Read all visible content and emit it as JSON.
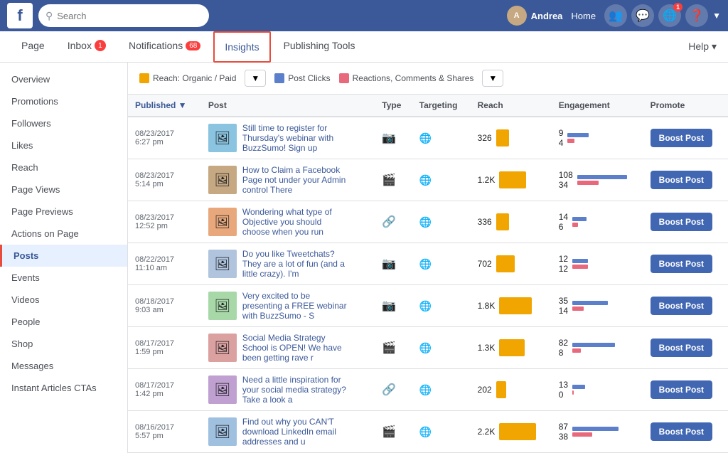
{
  "topNav": {
    "logo": "f",
    "search": {
      "placeholder": "Search",
      "value": ""
    },
    "userName": "Andrea",
    "navItems": [
      "Home",
      "Find Friends",
      "Messenger",
      "Globe",
      "Help",
      "More"
    ],
    "notifCount": "1"
  },
  "pageNav": {
    "items": [
      {
        "label": "Page",
        "active": false
      },
      {
        "label": "Inbox",
        "badge": "1",
        "active": false
      },
      {
        "label": "Notifications",
        "badge": "68",
        "active": false
      },
      {
        "label": "Insights",
        "active": true
      },
      {
        "label": "Publishing Tools",
        "active": false
      }
    ],
    "helpLabel": "Help ▾"
  },
  "sidebar": {
    "items": [
      {
        "label": "Overview",
        "active": false
      },
      {
        "label": "Promotions",
        "active": false
      },
      {
        "label": "Followers",
        "active": false
      },
      {
        "label": "Likes",
        "active": false
      },
      {
        "label": "Reach",
        "active": false
      },
      {
        "label": "Page Views",
        "active": false
      },
      {
        "label": "Page Previews",
        "active": false
      },
      {
        "label": "Actions on Page",
        "active": false
      },
      {
        "label": "Posts",
        "active": true
      },
      {
        "label": "Events",
        "active": false
      },
      {
        "label": "Videos",
        "active": false
      },
      {
        "label": "People",
        "active": false
      },
      {
        "label": "Shop",
        "active": false
      },
      {
        "label": "Messages",
        "active": false
      },
      {
        "label": "Instant Articles CTAs",
        "active": false
      }
    ]
  },
  "toolbar": {
    "reach_label": "Reach: Organic / Paid",
    "postclicks_label": "Post Clicks",
    "reactions_label": "Reactions, Comments & Shares",
    "reach_color": "#f0a500",
    "postclicks_color": "#5b7fcb",
    "reactions_color": "#e8697c"
  },
  "table": {
    "columns": [
      "Published",
      "Post",
      "Type",
      "Targeting",
      "Reach",
      "Engagement",
      "Promote"
    ],
    "rows": [
      {
        "date": "08/23/2017",
        "time": "6:27 pm",
        "postText": "Still time to register for Thursday's webinar with BuzzSumo! Sign up",
        "type": "📷",
        "target": "🌐",
        "reach": "326",
        "reachBarWidth": 18,
        "engNum1": "9",
        "engNum2": "4",
        "engBar1Width": 30,
        "engBar2Width": 10,
        "thumbBg": "#8bc4e0",
        "thumbEmoji": "🖼"
      },
      {
        "date": "08/23/2017",
        "time": "5:14 pm",
        "postText": "How to Claim a Facebook Page not under your Admin control There",
        "type": "🎬",
        "target": "🌐",
        "reach": "1.2K",
        "reachBarWidth": 38,
        "engNum1": "108",
        "engNum2": "34",
        "engBar1Width": 70,
        "engBar2Width": 30,
        "thumbBg": "#c6a882",
        "thumbEmoji": "🖼"
      },
      {
        "date": "08/23/2017",
        "time": "12:52 pm",
        "postText": "Wondering what type of Objective you should choose when you run",
        "type": "🔗",
        "target": "🌐",
        "reach": "336",
        "reachBarWidth": 18,
        "engNum1": "14",
        "engNum2": "6",
        "engBar1Width": 20,
        "engBar2Width": 8,
        "thumbBg": "#e8a87c",
        "thumbEmoji": "🖼"
      },
      {
        "date": "08/22/2017",
        "time": "11:10 am",
        "postText": "Do you like Tweetchats? They are a lot of fun (and a little crazy). I'm",
        "type": "📷",
        "target": "🌐",
        "reach": "702",
        "reachBarWidth": 26,
        "engNum1": "12",
        "engNum2": "12",
        "engBar1Width": 22,
        "engBar2Width": 22,
        "thumbBg": "#b0c4de",
        "thumbEmoji": "🖼"
      },
      {
        "date": "08/18/2017",
        "time": "9:03 am",
        "postText": "Very excited to be presenting a FREE webinar with BuzzSumo - S",
        "type": "📷",
        "target": "🌐",
        "reach": "1.8K",
        "reachBarWidth": 46,
        "engNum1": "35",
        "engNum2": "14",
        "engBar1Width": 50,
        "engBar2Width": 16,
        "thumbBg": "#a8d8a8",
        "thumbEmoji": "🖼"
      },
      {
        "date": "08/17/2017",
        "time": "1:59 pm",
        "postText": "Social Media Strategy School is OPEN! We have been getting rave r",
        "type": "🎬",
        "target": "🌐",
        "reach": "1.3K",
        "reachBarWidth": 36,
        "engNum1": "82",
        "engNum2": "8",
        "engBar1Width": 60,
        "engBar2Width": 12,
        "thumbBg": "#dba0a0",
        "thumbEmoji": "🖼"
      },
      {
        "date": "08/17/2017",
        "time": "1:42 pm",
        "postText": "Need a little inspiration for your social media strategy? Take a look a",
        "type": "🔗",
        "target": "🌐",
        "reach": "202",
        "reachBarWidth": 14,
        "engNum1": "13",
        "engNum2": "0",
        "engBar1Width": 18,
        "engBar2Width": 2,
        "thumbBg": "#c0a0d0",
        "thumbEmoji": "🖼"
      },
      {
        "date": "08/16/2017",
        "time": "5:57 pm",
        "postText": "Find out why you CAN'T download LinkedIn email addresses and u",
        "type": "🎬",
        "target": "🌐",
        "reach": "2.2K",
        "reachBarWidth": 52,
        "engNum1": "87",
        "engNum2": "38",
        "engBar1Width": 65,
        "engBar2Width": 28,
        "thumbBg": "#a0c0e0",
        "thumbEmoji": "🖼"
      }
    ],
    "boostLabel": "Boost Post"
  }
}
